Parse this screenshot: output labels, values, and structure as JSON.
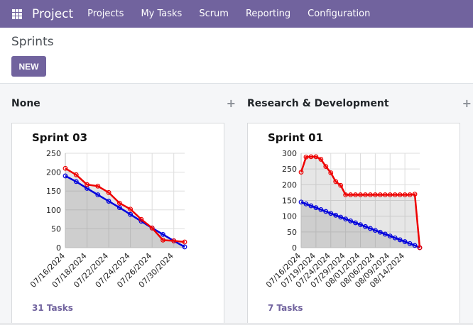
{
  "navbar": {
    "brand": "Project",
    "menu": [
      "Projects",
      "My Tasks",
      "Scrum",
      "Reporting",
      "Configuration"
    ]
  },
  "control_panel": {
    "breadcrumb": "Sprints",
    "new_label": "NEW"
  },
  "columns": [
    {
      "title": "None",
      "add_icon": "plus-icon",
      "card": {
        "title": "Sprint 03",
        "tasks_label": "31 Tasks"
      }
    },
    {
      "title": "Research & Development",
      "add_icon": "plus-icon",
      "card": {
        "title": "Sprint 01",
        "tasks_label": "7 Tasks"
      }
    }
  ],
  "colors": {
    "brand": "#71639e",
    "ideal_line": "#0000dd",
    "actual_line": "#ee0000"
  },
  "chart_data": [
    {
      "type": "line",
      "ylim": [
        0,
        250
      ],
      "yticks": [
        0,
        50,
        100,
        150,
        200,
        250
      ],
      "x_tick_labels": [
        "07/16/2024",
        "07/18/2024",
        "07/22/2024",
        "07/24/2024",
        "07/26/2024",
        "07/30/2024"
      ],
      "x_tick_index": [
        0,
        2,
        4,
        6,
        8,
        10
      ],
      "n_points": 12,
      "series": [
        {
          "values": [
            190,
            175,
            157,
            140,
            123,
            106,
            88,
            70,
            52,
            35,
            18,
            2
          ]
        },
        {
          "values": [
            210,
            193,
            167,
            163,
            146,
            118,
            102,
            75,
            52,
            20,
            18,
            15
          ]
        }
      ],
      "grid": true
    },
    {
      "type": "line",
      "ylim": [
        0,
        300
      ],
      "yticks": [
        0,
        50,
        100,
        150,
        200,
        250,
        300
      ],
      "x_tick_labels": [
        "07/16/2024",
        "07/19/2024",
        "07/24/2024",
        "07/29/2024",
        "08/01/2024",
        "08/06/2024",
        "08/09/2024",
        "08/14/2024"
      ],
      "x_tick_index": [
        0,
        3,
        6,
        9,
        12,
        15,
        18,
        21
      ],
      "n_points": 25,
      "series": [
        {
          "values": [
            145,
            139,
            133,
            127,
            121,
            115,
            109,
            103,
            97,
            91,
            85,
            79,
            73,
            67,
            61,
            55,
            49,
            43,
            37,
            31,
            25,
            19,
            13,
            7,
            0
          ]
        },
        {
          "values": [
            240,
            288,
            289,
            289,
            281,
            258,
            238,
            210,
            198,
            168,
            168,
            168,
            168,
            168,
            168,
            168,
            168,
            168,
            168,
            168,
            168,
            168,
            168,
            170,
            0
          ]
        }
      ],
      "grid": true
    }
  ]
}
